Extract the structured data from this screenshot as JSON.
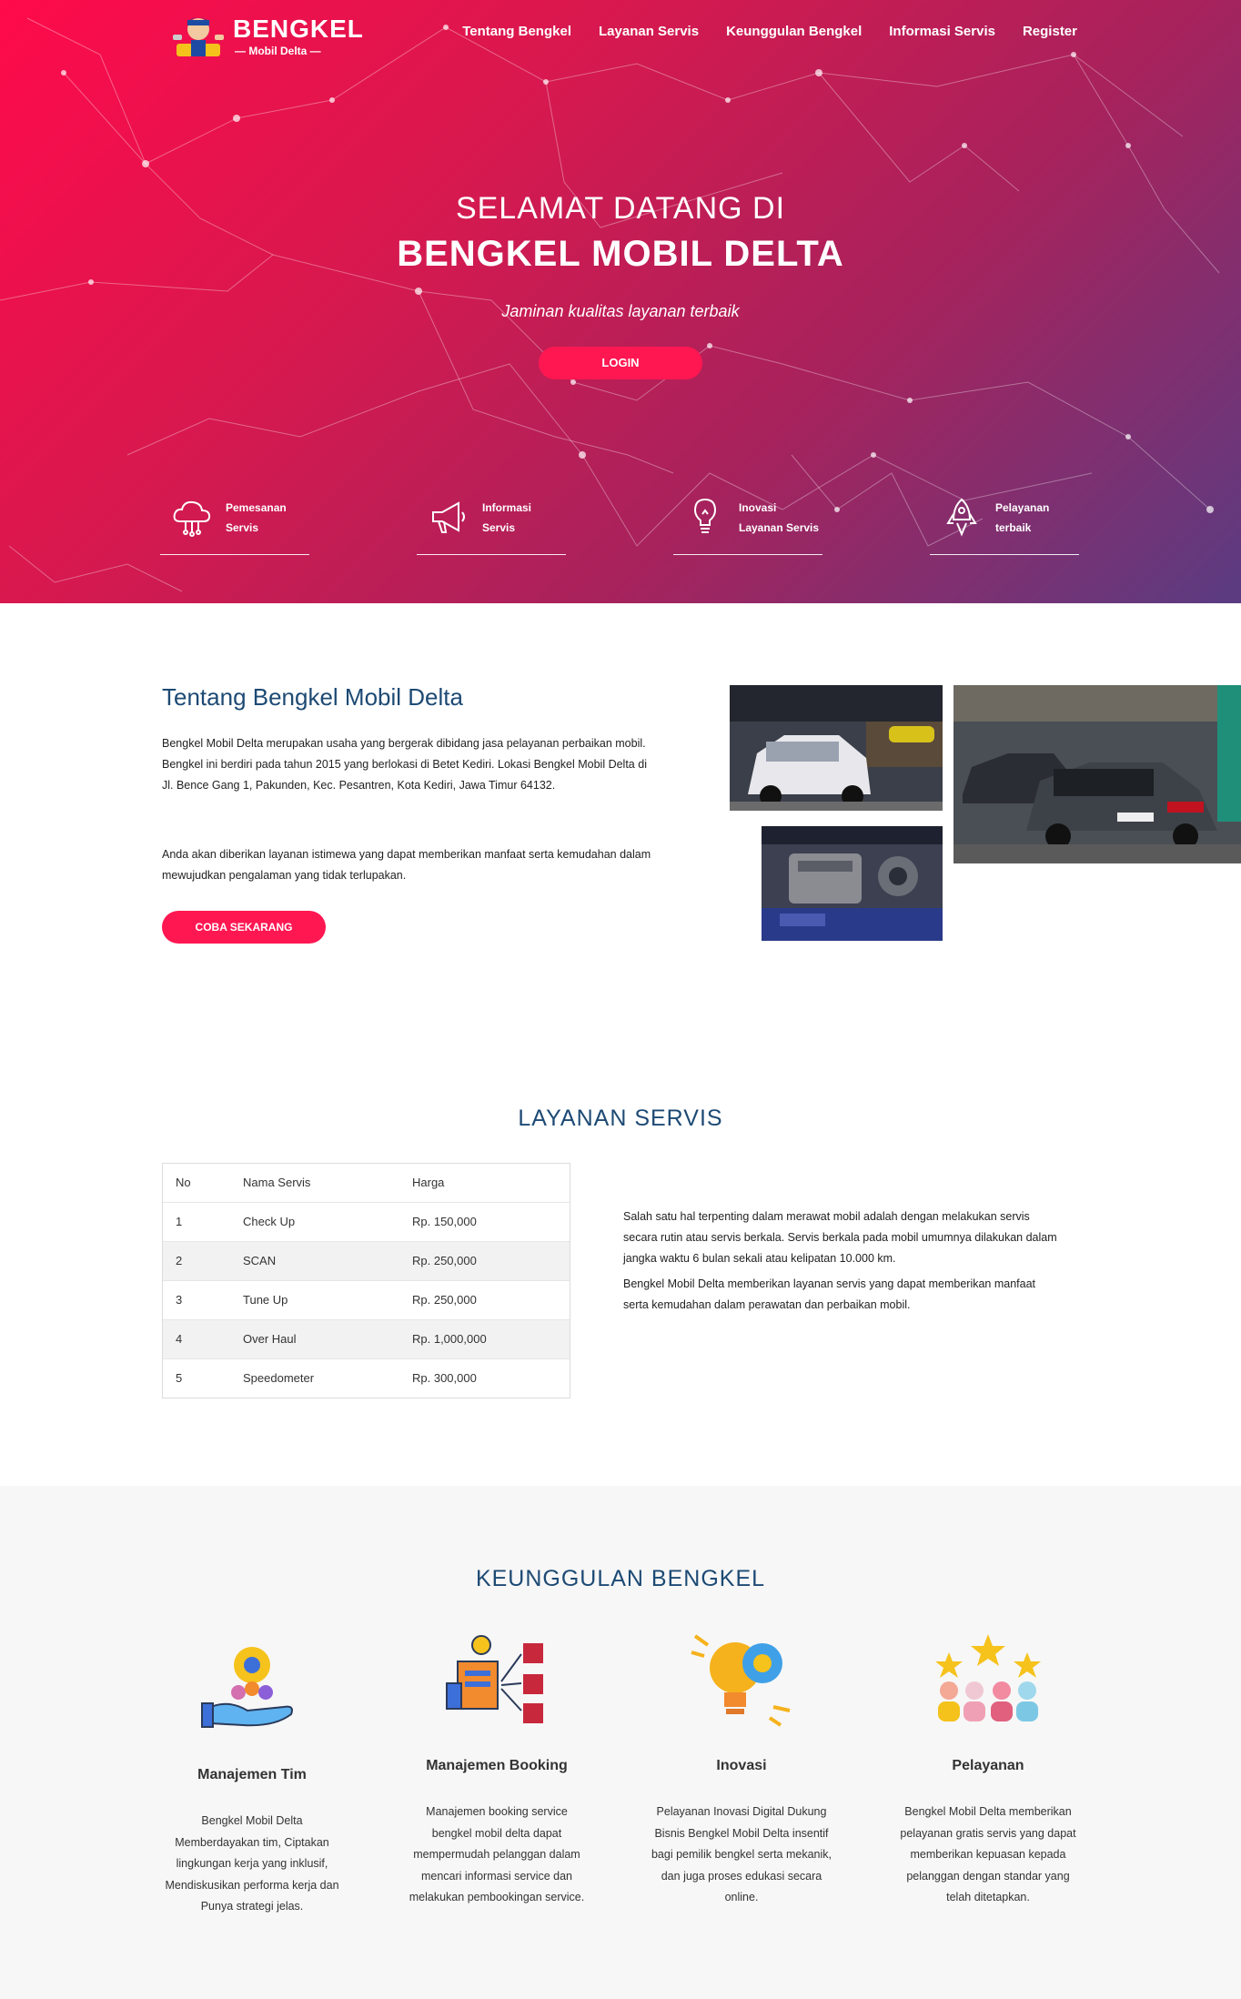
{
  "nav": {
    "logo_title": "BENGKEL",
    "logo_sub": "— Mobil Delta —",
    "menu": [
      "Tentang Bengkel",
      "Layanan Servis",
      "Keunggulan Bengkel",
      "Informasi Servis",
      "Register"
    ]
  },
  "hero": {
    "line1": "SELAMAT DATANG DI",
    "line2": "BENGKEL MOBIL DELTA",
    "tagline": "Jaminan kualitas layanan terbaik",
    "login_label": "LOGIN",
    "features": [
      {
        "line1": "Pemesanan",
        "line2": "Servis",
        "icon": "cloud-network-icon"
      },
      {
        "line1": "Informasi",
        "line2": "Servis",
        "icon": "megaphone-icon"
      },
      {
        "line1": "Inovasi",
        "line2": "Layanan Servis",
        "icon": "lightbulb-icon"
      },
      {
        "line1": "Pelayanan",
        "line2": "terbaik",
        "icon": "rocket-icon"
      }
    ]
  },
  "about": {
    "title": "Tentang Bengkel Mobil Delta",
    "p1": "Bengkel Mobil Delta merupakan usaha yang bergerak dibidang jasa pelayanan perbaikan mobil. Bengkel ini berdiri pada tahun 2015 yang berlokasi di Betet Kediri. Lokasi Bengkel Mobil Delta di Jl. Bence Gang 1, Pakunden, Kec. Pesantren, Kota Kediri, Jawa Timur 64132.",
    "p2": "Anda akan diberikan layanan istimewa yang dapat memberikan manfaat serta kemudahan dalam mewujudkan pengalaman yang tidak terlupakan.",
    "cta": "COBA SEKARANG"
  },
  "layanan": {
    "title": "LAYANAN SERVIS",
    "headers": [
      "No",
      "Nama Servis",
      "Harga"
    ],
    "rows": [
      [
        "1",
        "Check Up",
        "Rp. 150,000"
      ],
      [
        "2",
        "SCAN",
        "Rp. 250,000"
      ],
      [
        "3",
        "Tune Up",
        "Rp. 250,000"
      ],
      [
        "4",
        "Over Haul",
        "Rp. 1,000,000"
      ],
      [
        "5",
        "Speedometer",
        "Rp. 300,000"
      ]
    ],
    "p1": "Salah satu hal terpenting dalam merawat mobil adalah dengan melakukan servis secara rutin atau servis berkala. Servis berkala pada mobil umumnya dilakukan dalam jangka waktu 6 bulan sekali atau kelipatan 10.000 km.",
    "p2": "Bengkel Mobil Delta memberikan layanan servis yang dapat memberikan manfaat serta kemudahan dalam perawatan dan perbaikan mobil."
  },
  "keunggulan": {
    "title": "KEUNGGULAN BENGKEL",
    "cards": [
      {
        "title": "Manajemen Tim",
        "text": "Bengkel Mobil Delta Memberdayakan tim, Ciptakan lingkungan kerja yang inklusif, Mendiskusikan performa kerja dan Punya strategi jelas.",
        "icon": "team-management-icon"
      },
      {
        "title": "Manajemen Booking",
        "text": "Manajemen booking service bengkel mobil delta dapat mempermudah pelanggan dalam mencari informasi service dan melakukan pembookingan service.",
        "icon": "booking-management-icon"
      },
      {
        "title": "Inovasi",
        "text": "Pelayanan Inovasi Digital Dukung Bisnis Bengkel Mobil Delta insentif bagi pemilik bengkel serta mekanik, dan juga proses edukasi secara online.",
        "icon": "innovation-icon"
      },
      {
        "title": "Pelayanan",
        "text": "Bengkel Mobil Delta memberikan pelayanan gratis servis yang dapat memberikan kepuasan kepada pelanggan dengan standar yang telah ditetapkan.",
        "icon": "service-stars-icon"
      }
    ]
  },
  "colors": {
    "accent": "#ff1752",
    "heading": "#1d4a74"
  }
}
